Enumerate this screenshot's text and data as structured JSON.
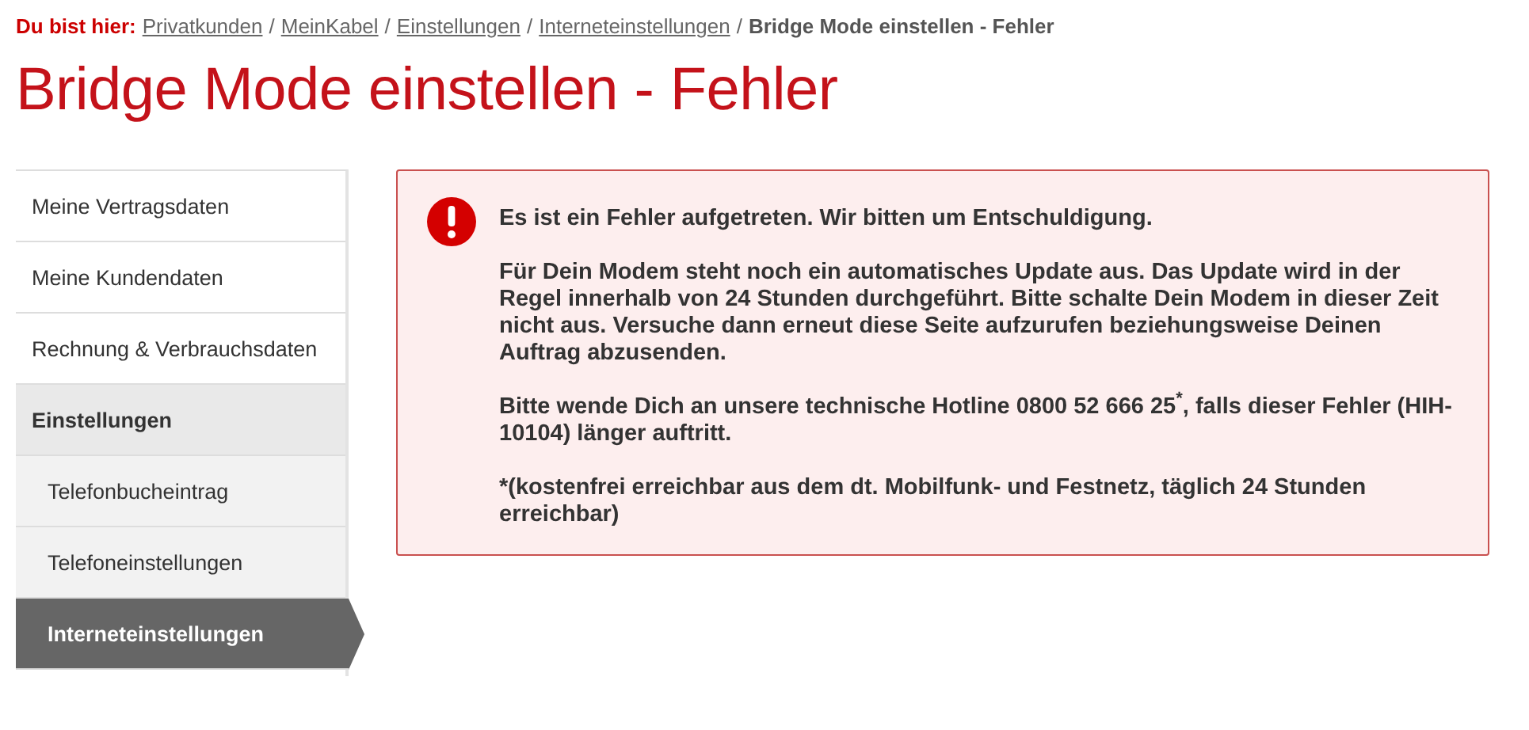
{
  "breadcrumb": {
    "label": "Du bist hier:",
    "links": [
      "Privatkunden",
      "MeinKabel",
      "Einstellungen",
      "Interneteinstellungen"
    ],
    "separator": "/",
    "current": "Bridge Mode einstellen - Fehler"
  },
  "title": "Bridge Mode einstellen - Fehler",
  "sidebar": {
    "items": [
      {
        "label": "Meine Vertragsdaten",
        "kind": "item",
        "selected": false
      },
      {
        "label": "Meine Kundendaten",
        "kind": "item",
        "selected": false
      },
      {
        "label": "Rechnung & Verbrauchsdaten",
        "kind": "item",
        "selected": false
      },
      {
        "label": "Einstellungen",
        "kind": "group",
        "selected": false
      },
      {
        "label": "Telefonbucheintrag",
        "kind": "sub",
        "selected": false
      },
      {
        "label": "Telefoneinstellungen",
        "kind": "sub",
        "selected": false
      },
      {
        "label": "Interneteinstellungen",
        "kind": "sub",
        "selected": true
      }
    ]
  },
  "alert": {
    "kind": "error",
    "paragraphs": [
      "Es ist ein Fehler aufgetreten. Wir bitten um Entschuldigung.",
      "Für Dein Modem steht noch ein automatisches Update aus. Das Update wird in der Regel innerhalb von 24 Stunden durchgeführt. Bitte schalte Dein Modem in dieser Zeit nicht aus. Versuche dann erneut diese Seite aufzurufen beziehungsweise Deinen Auftrag abzusenden.",
      "Bitte wende Dich an unsere technische Hotline 0800 52 666 25$^{*}$, falls dieser Fehler (HIH-10104) länger auftritt.",
      "*(kostenfrei erreichbar aus dem dt. Mobilfunk- und Festnetz, täglich 24 Stunden erreichbar)"
    ]
  }
}
